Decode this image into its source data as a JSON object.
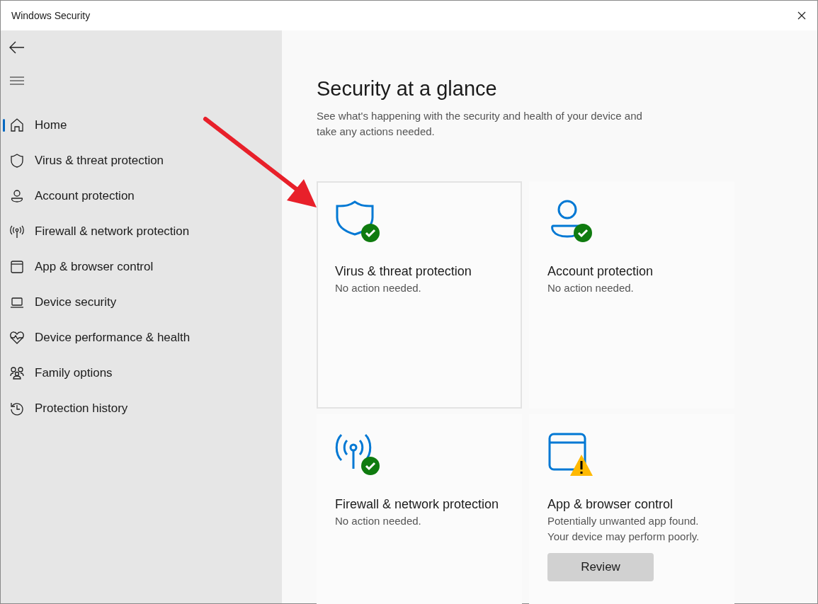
{
  "window": {
    "title": "Windows Security"
  },
  "sidebar": {
    "items": [
      {
        "label": "Home",
        "kind": "home",
        "selected": true
      },
      {
        "label": "Virus & threat protection",
        "kind": "shield",
        "selected": false
      },
      {
        "label": "Account protection",
        "kind": "person",
        "selected": false
      },
      {
        "label": "Firewall & network protection",
        "kind": "antenna",
        "selected": false
      },
      {
        "label": "App & browser control",
        "kind": "window",
        "selected": false
      },
      {
        "label": "Device security",
        "kind": "laptop",
        "selected": false
      },
      {
        "label": "Device performance & health",
        "kind": "heart",
        "selected": false
      },
      {
        "label": "Family options",
        "kind": "family",
        "selected": false
      },
      {
        "label": "Protection history",
        "kind": "history",
        "selected": false
      }
    ]
  },
  "main": {
    "heading": "Security at a glance",
    "description": "See what's happening with the security and health of your device and take any actions needed.",
    "cards": [
      {
        "kind": "shield",
        "warning": false,
        "highlighted": true,
        "title": "Virus & threat protection",
        "lines": [
          "No action needed."
        ]
      },
      {
        "kind": "person",
        "warning": false,
        "highlighted": false,
        "title": "Account protection",
        "lines": [
          "No action needed."
        ]
      },
      {
        "kind": "antenna",
        "warning": false,
        "highlighted": false,
        "title": "Firewall & network protection",
        "lines": [
          "No action needed."
        ]
      },
      {
        "kind": "window",
        "warning": true,
        "highlighted": false,
        "title": "App & browser control",
        "lines": [
          "Potentially unwanted app found.",
          "Your device may perform poorly."
        ],
        "button": "Review"
      }
    ]
  },
  "annotation": {
    "kind": "arrow"
  }
}
